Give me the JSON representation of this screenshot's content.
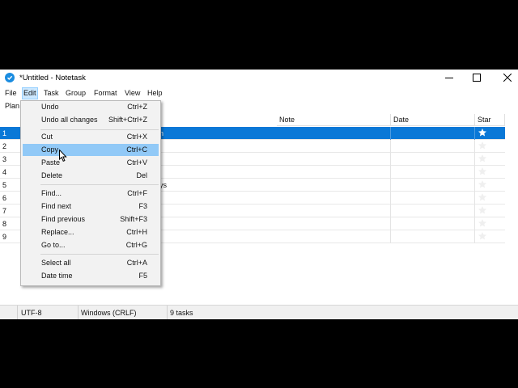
{
  "window": {
    "title": "*Untitled - Notetask"
  },
  "menubar": {
    "items": [
      "File",
      "Edit",
      "Task",
      "Group",
      "Format",
      "View",
      "Help"
    ],
    "active": "Edit"
  },
  "toolbar": {
    "plan_label": "Plan"
  },
  "grid": {
    "headers": {
      "note": "Note",
      "date": "Date",
      "star": "Star"
    },
    "rows": [
      {
        "num": "1",
        "text": "n",
        "starred": true,
        "selected": true
      },
      {
        "num": "2",
        "text": "",
        "starred": false
      },
      {
        "num": "3",
        "text": "",
        "starred": false
      },
      {
        "num": "4",
        "text": "",
        "starred": false
      },
      {
        "num": "5",
        "text": "ys",
        "starred": false
      },
      {
        "num": "6",
        "text": "",
        "starred": false
      },
      {
        "num": "7",
        "text": "",
        "starred": false
      },
      {
        "num": "8",
        "text": "",
        "starred": false
      },
      {
        "num": "9",
        "text": "",
        "starred": false
      }
    ]
  },
  "edit_menu": {
    "items": [
      {
        "label": "Undo",
        "shortcut": "Ctrl+Z"
      },
      {
        "label": "Undo all changes",
        "shortcut": "Shift+Ctrl+Z"
      },
      {
        "label": "Cut",
        "shortcut": "Ctrl+X"
      },
      {
        "label": "Copy",
        "shortcut": "Ctrl+C",
        "highlighted": true
      },
      {
        "label": "Paste",
        "shortcut": "Ctrl+V"
      },
      {
        "label": "Delete",
        "shortcut": "Del"
      },
      {
        "label": "Find...",
        "shortcut": "Ctrl+F"
      },
      {
        "label": "Find next",
        "shortcut": "F3"
      },
      {
        "label": "Find previous",
        "shortcut": "Shift+F3"
      },
      {
        "label": "Replace...",
        "shortcut": "Ctrl+H"
      },
      {
        "label": "Go to...",
        "shortcut": "Ctrl+G"
      },
      {
        "label": "Select all",
        "shortcut": "Ctrl+A"
      },
      {
        "label": "Date time",
        "shortcut": "F5"
      }
    ]
  },
  "statusbar": {
    "encoding": "UTF-8",
    "line_endings": "Windows (CRLF)",
    "task_count": "9 tasks"
  },
  "colors": {
    "selection": "#0a78d7",
    "menu_highlight": "#91c9f7",
    "app_icon": "#1a8ce0"
  }
}
